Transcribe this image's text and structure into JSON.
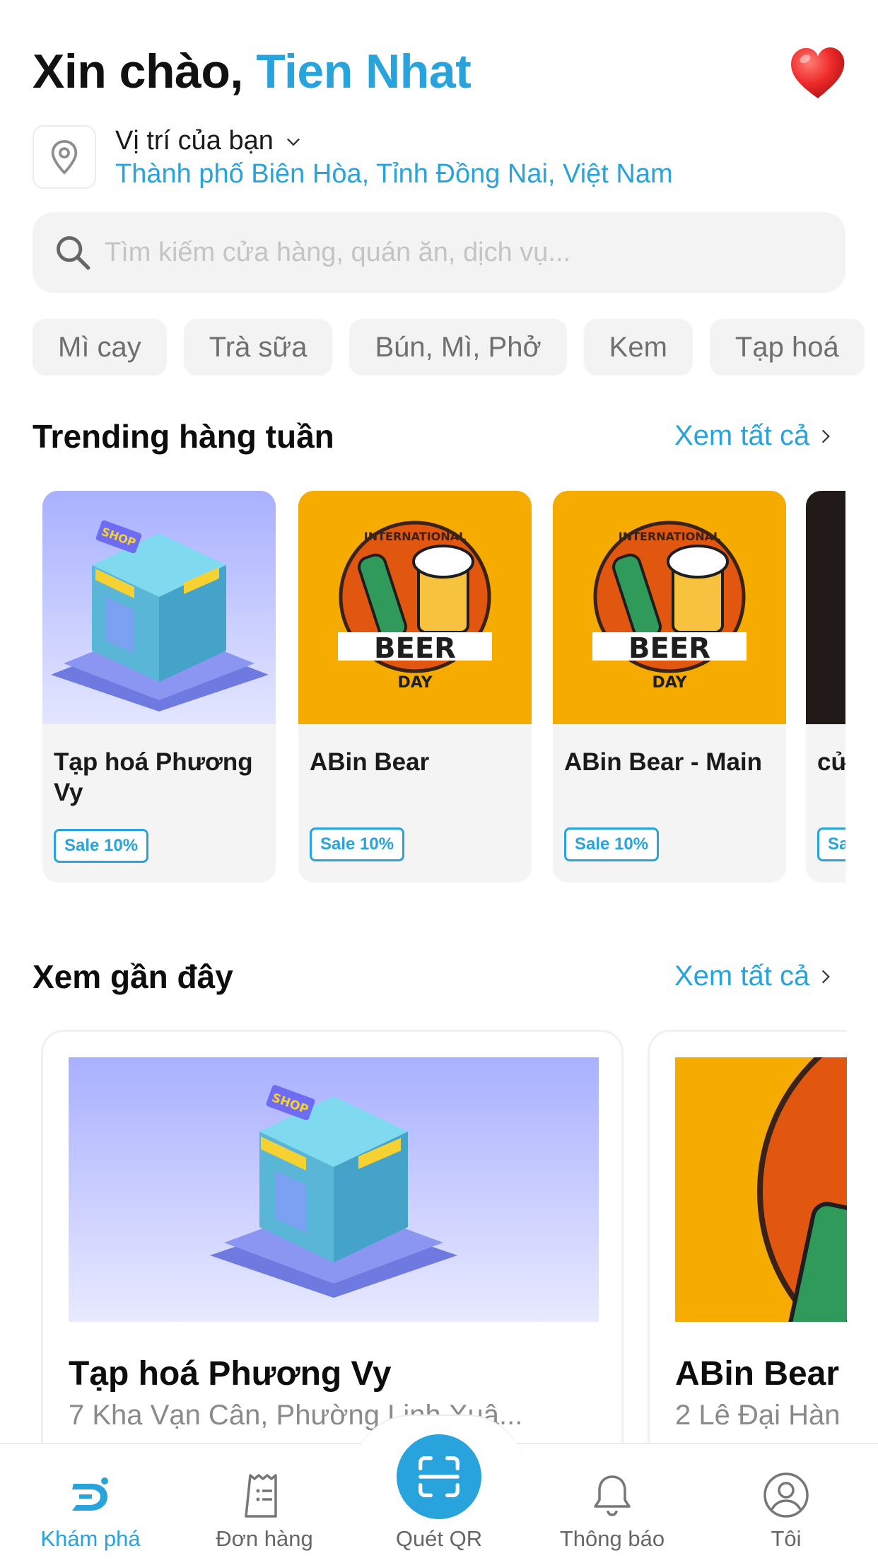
{
  "header": {
    "greeting": "Xin chào,",
    "user_name": "Tien Nhat",
    "location_label": "Vị trí của bạn",
    "location_value": "Thành phố Biên Hòa, Tỉnh Đồng Nai, Việt Nam"
  },
  "search": {
    "placeholder": "Tìm kiếm cửa hàng, quán ăn, dịch vụ...",
    "value": ""
  },
  "categories": [
    "Mì cay",
    "Trà sữa",
    "Bún, Mì, Phở",
    "Kem",
    "Tạp hoá"
  ],
  "trending": {
    "title": "Trending hàng tuần",
    "see_all": "Xem tất cả",
    "items": [
      {
        "name": "Tạp hoá Phương Vy",
        "badge": "Sale 10%",
        "image": "shop-illustration"
      },
      {
        "name": "ABin Bear",
        "badge": "Sale 10%",
        "image": "beer-day-poster"
      },
      {
        "name": "ABin Bear - Main",
        "badge": "Sale 10%",
        "image": "beer-day-poster"
      },
      {
        "name": "cử",
        "badge": "Sa",
        "image": "dark-poster"
      }
    ]
  },
  "recent": {
    "title": "Xem gần đây",
    "see_all": "Xem tất cả",
    "items": [
      {
        "name": "Tạp hoá Phương Vy",
        "address": "7 Kha Vạn Cân, Phường Linh Xuâ...",
        "image": "shop-illustration"
      },
      {
        "name": "ABin Bear",
        "address": "2 Lê Đại Hàn",
        "image": "beer-day-poster"
      }
    ]
  },
  "bottom_nav": {
    "items": [
      {
        "label": "Khám phá",
        "icon": "explore-logo-icon",
        "active": true
      },
      {
        "label": "Đơn hàng",
        "icon": "receipt-icon",
        "active": false
      },
      {
        "label": "Quét QR",
        "icon": "qr-scan-icon",
        "active": false
      },
      {
        "label": "Thông báo",
        "icon": "bell-icon",
        "active": false
      },
      {
        "label": "Tôi",
        "icon": "user-circle-icon",
        "active": false
      }
    ]
  },
  "colors": {
    "accent": "#29a3dc",
    "chip_bg": "#f3f3f3",
    "beer_bg": "#f5ab00",
    "shop_bg": "#b8bdff"
  }
}
